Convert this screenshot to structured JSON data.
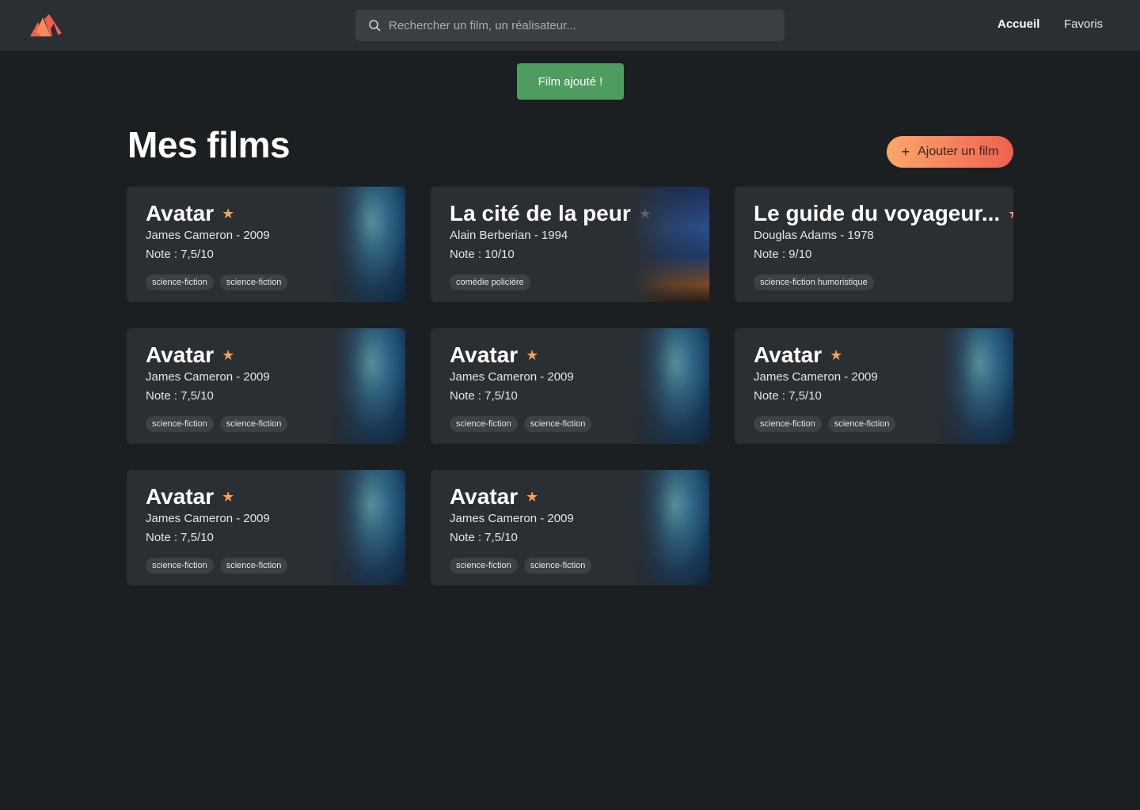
{
  "header": {
    "search_placeholder": "Rechercher un film, un réalisateur...",
    "nav": {
      "home": "Accueil",
      "favorites": "Favoris"
    },
    "accent": "#f0604f"
  },
  "toast": {
    "text": "Film ajouté !",
    "color": "#4e9c5f"
  },
  "main": {
    "title": "Mes films",
    "add_button": "Ajouter un film"
  },
  "films": [
    {
      "title": "Avatar",
      "favorite": true,
      "meta": "James Cameron - 2009",
      "rating": "Note : 7,5/10",
      "tags": [
        "science-fiction",
        "science-fiction"
      ],
      "poster": "avatar"
    },
    {
      "title": "La cité de la peur",
      "favorite": false,
      "meta": "Alain Berberian - 1994",
      "rating": "Note : 10/10",
      "tags": [
        "comédie policière"
      ],
      "poster": "cite"
    },
    {
      "title": "Le guide du voyageur...",
      "favorite": true,
      "meta": "Douglas Adams - 1978",
      "rating": "Note : 9/10",
      "tags": [
        "science-fiction humoristique"
      ],
      "poster": ""
    },
    {
      "title": "Avatar",
      "favorite": true,
      "meta": "James Cameron - 2009",
      "rating": "Note : 7,5/10",
      "tags": [
        "science-fiction",
        "science-fiction"
      ],
      "poster": "avatar"
    },
    {
      "title": "Avatar",
      "favorite": true,
      "meta": "James Cameron - 2009",
      "rating": "Note : 7,5/10",
      "tags": [
        "science-fiction",
        "science-fiction"
      ],
      "poster": "avatar"
    },
    {
      "title": "Avatar",
      "favorite": true,
      "meta": "James Cameron - 2009",
      "rating": "Note : 7,5/10",
      "tags": [
        "science-fiction",
        "science-fiction"
      ],
      "poster": "avatar"
    },
    {
      "title": "Avatar",
      "favorite": true,
      "meta": "James Cameron - 2009",
      "rating": "Note : 7,5/10",
      "tags": [
        "science-fiction",
        "science-fiction"
      ],
      "poster": "avatar"
    },
    {
      "title": "Avatar",
      "favorite": true,
      "meta": "James Cameron - 2009",
      "rating": "Note : 7,5/10",
      "tags": [
        "science-fiction",
        "science-fiction"
      ],
      "poster": "avatar"
    }
  ]
}
